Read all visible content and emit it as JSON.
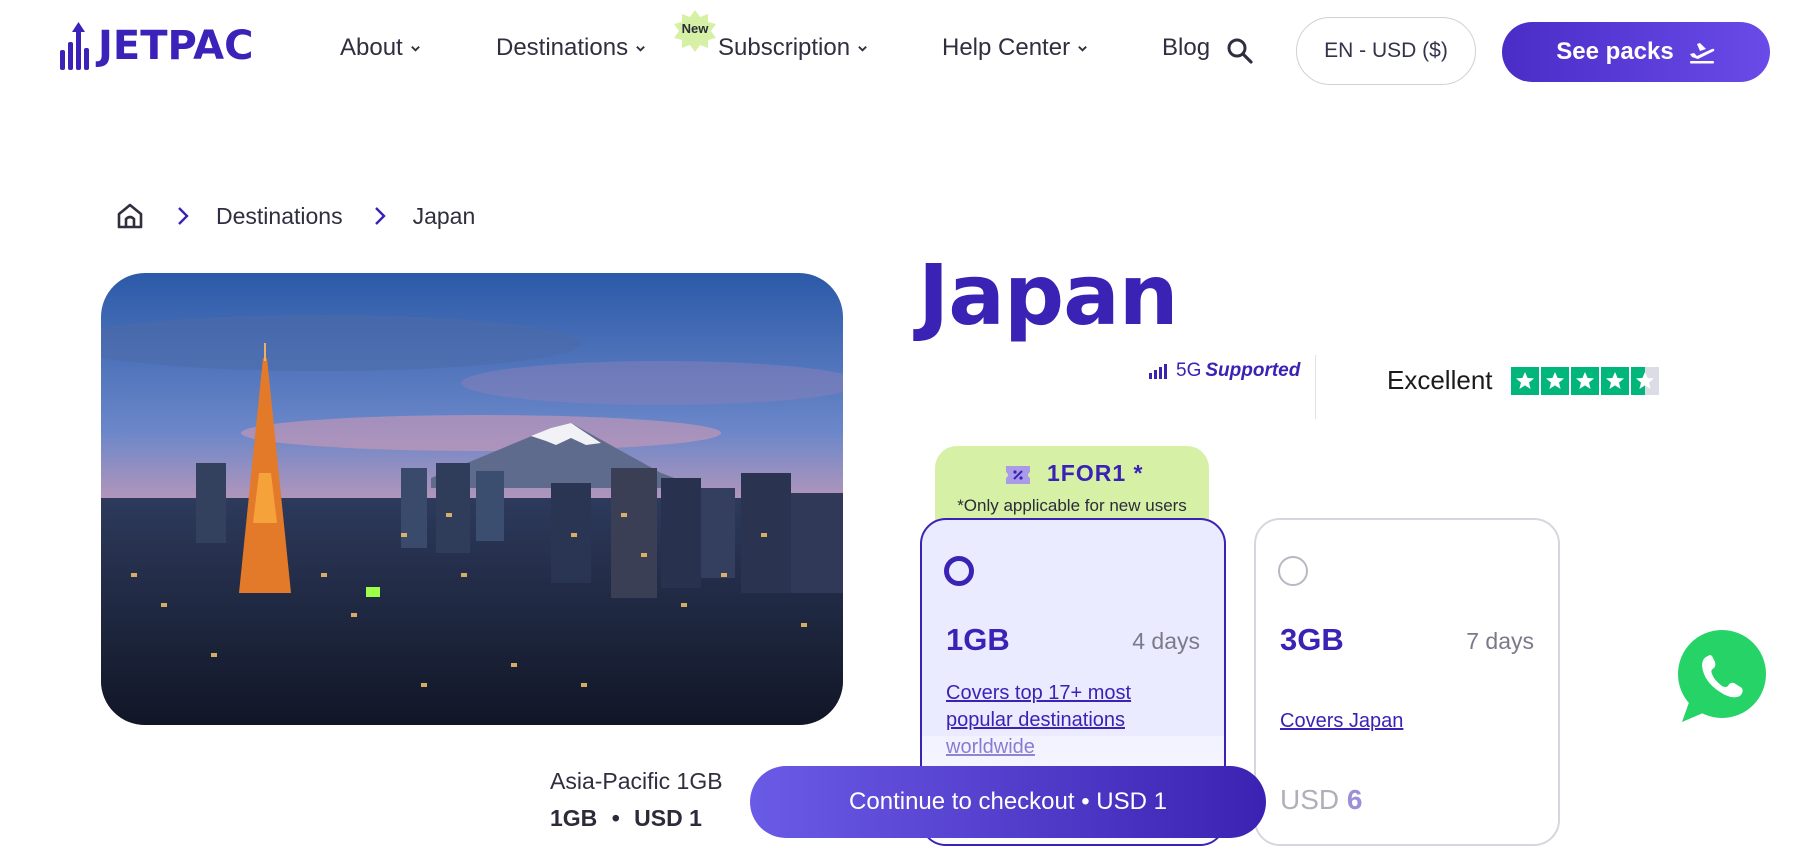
{
  "header": {
    "logo_text": "JETPAC",
    "nav": [
      {
        "label": "About"
      },
      {
        "label": "Destinations"
      },
      {
        "label": "Subscription",
        "badge": "New"
      },
      {
        "label": "Help Center"
      },
      {
        "label": "Blog"
      }
    ],
    "language_label": "EN - USD ($)",
    "cta_label": "See packs"
  },
  "breadcrumb": {
    "items": [
      "Destinations",
      "Japan"
    ]
  },
  "product": {
    "title": "Japan",
    "network_label": "5G",
    "network_supported": "Supported",
    "rating_label": "Excellent",
    "rating_stars": 4.5
  },
  "promo": {
    "code": "1FOR1 *",
    "note": "*Only applicable for new users"
  },
  "packs": [
    {
      "data": "1GB",
      "duration": "4 days",
      "coverage": "Covers top 17+ most popular destinations worldwide",
      "selected": true
    },
    {
      "data": "3GB",
      "duration": "7 days",
      "coverage": "Covers Japan",
      "price_currency": "USD",
      "price_value": "6",
      "selected": false
    }
  ],
  "checkout": {
    "pack_name": "Asia-Pacific 1GB",
    "pack_data": "1GB",
    "separator": "•",
    "pack_price": "USD 1",
    "button_label": "Continue to checkout • USD 1"
  },
  "colors": {
    "brand": "#3a22b5",
    "promo_bg": "#d6f0a6",
    "whatsapp": "#25d366",
    "trustpilot": "#00b67a"
  }
}
